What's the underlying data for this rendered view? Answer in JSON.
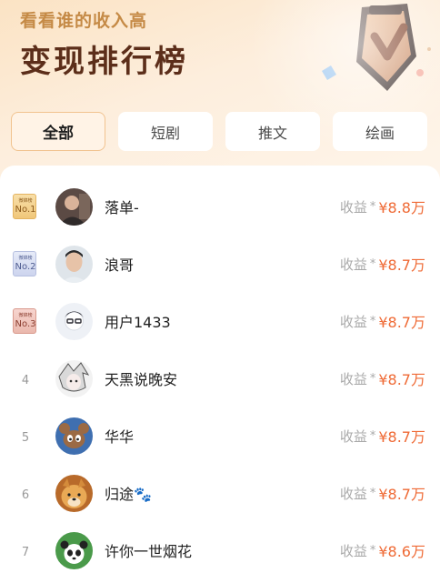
{
  "header": {
    "subtitle": "看看谁的收入高",
    "title": "变现排行榜"
  },
  "tabs": [
    {
      "label": "全部",
      "active": true
    },
    {
      "label": "短剧",
      "active": false
    },
    {
      "label": "推文",
      "active": false
    },
    {
      "label": "绘画",
      "active": false
    }
  ],
  "medal_text": {
    "top": "微锦榜",
    "no1": "No.1",
    "no2": "No.2",
    "no3": "No.3"
  },
  "earnings_label": "收益",
  "earnings_separator": "*",
  "ranking": [
    {
      "rank": "1",
      "name": "落单-",
      "amount": "¥8.8万",
      "avatar": "photo-avatar"
    },
    {
      "rank": "2",
      "name": "浪哥",
      "amount": "¥8.7万",
      "avatar": "photo-avatar"
    },
    {
      "rank": "3",
      "name": "用户1433",
      "amount": "¥8.7万",
      "avatar": "default-avatar"
    },
    {
      "rank": "4",
      "name": "天黑说晚安",
      "amount": "¥8.7万",
      "avatar": "anime-avatar"
    },
    {
      "rank": "5",
      "name": "华华",
      "amount": "¥8.7万",
      "avatar": "cartoon-avatar"
    },
    {
      "rank": "6",
      "name": "归途🐾",
      "amount": "¥8.7万",
      "avatar": "dog-avatar"
    },
    {
      "rank": "7",
      "name": "许你一世烟花",
      "amount": "¥8.6万",
      "avatar": "panda-avatar"
    }
  ],
  "colors": {
    "accent": "#ef6a35",
    "title": "#5c2e1a",
    "subtitle": "#c58a46",
    "tab_active_border": "#f1c38f"
  }
}
